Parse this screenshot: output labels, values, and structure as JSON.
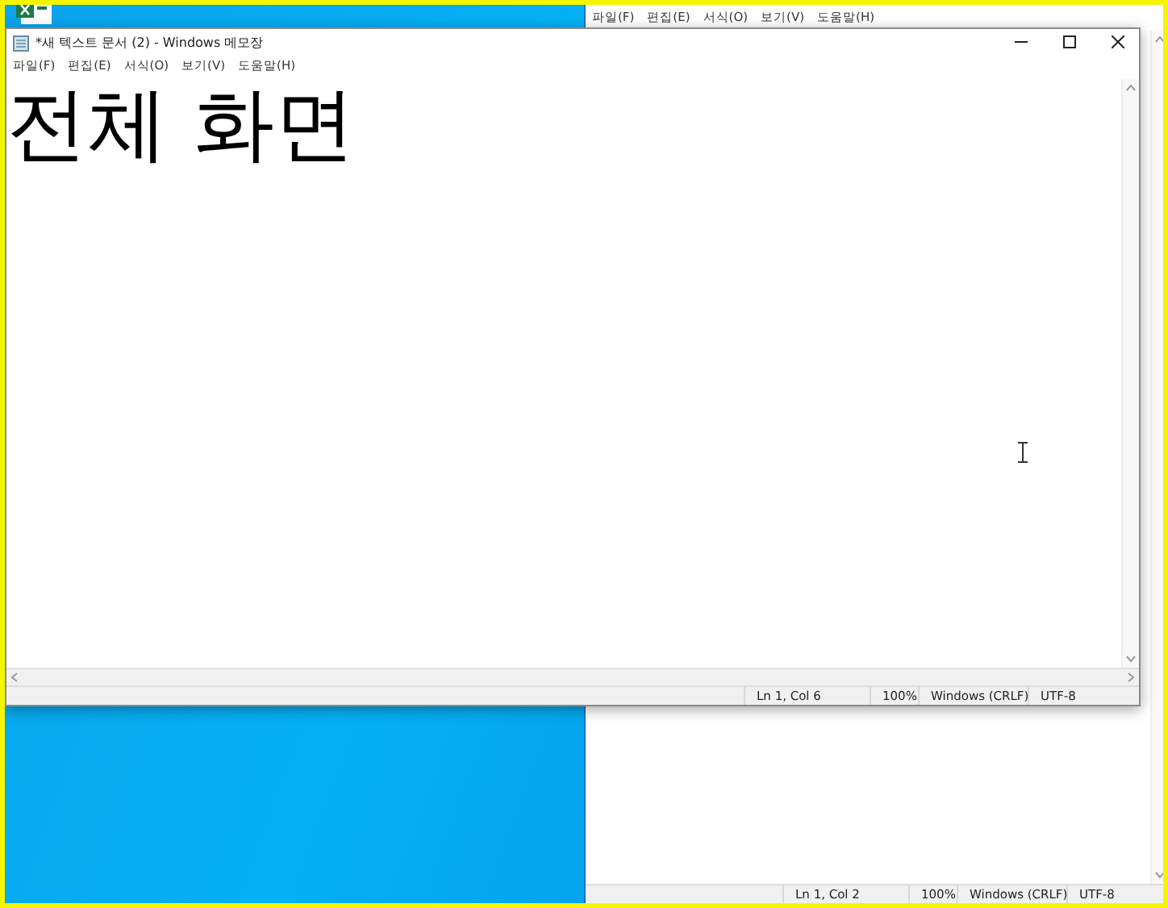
{
  "background_window": {
    "menu": [
      "파일(F)",
      "편집(E)",
      "서식(O)",
      "보기(V)",
      "도움말(H)"
    ],
    "status": {
      "position": "Ln 1, Col 2",
      "zoom": "100%",
      "line_ending": "Windows (CRLF)",
      "encoding": "UTF-8"
    }
  },
  "front_window": {
    "title": "*새 텍스트 문서 (2) - Windows 메모장",
    "menu": [
      "파일(F)",
      "편집(E)",
      "서식(O)",
      "보기(V)",
      "도움말(H)"
    ],
    "content": "전체 화면",
    "status": {
      "position": "Ln 1, Col 6",
      "zoom": "100%",
      "line_ending": "Windows (CRLF)",
      "encoding": "UTF-8"
    }
  }
}
